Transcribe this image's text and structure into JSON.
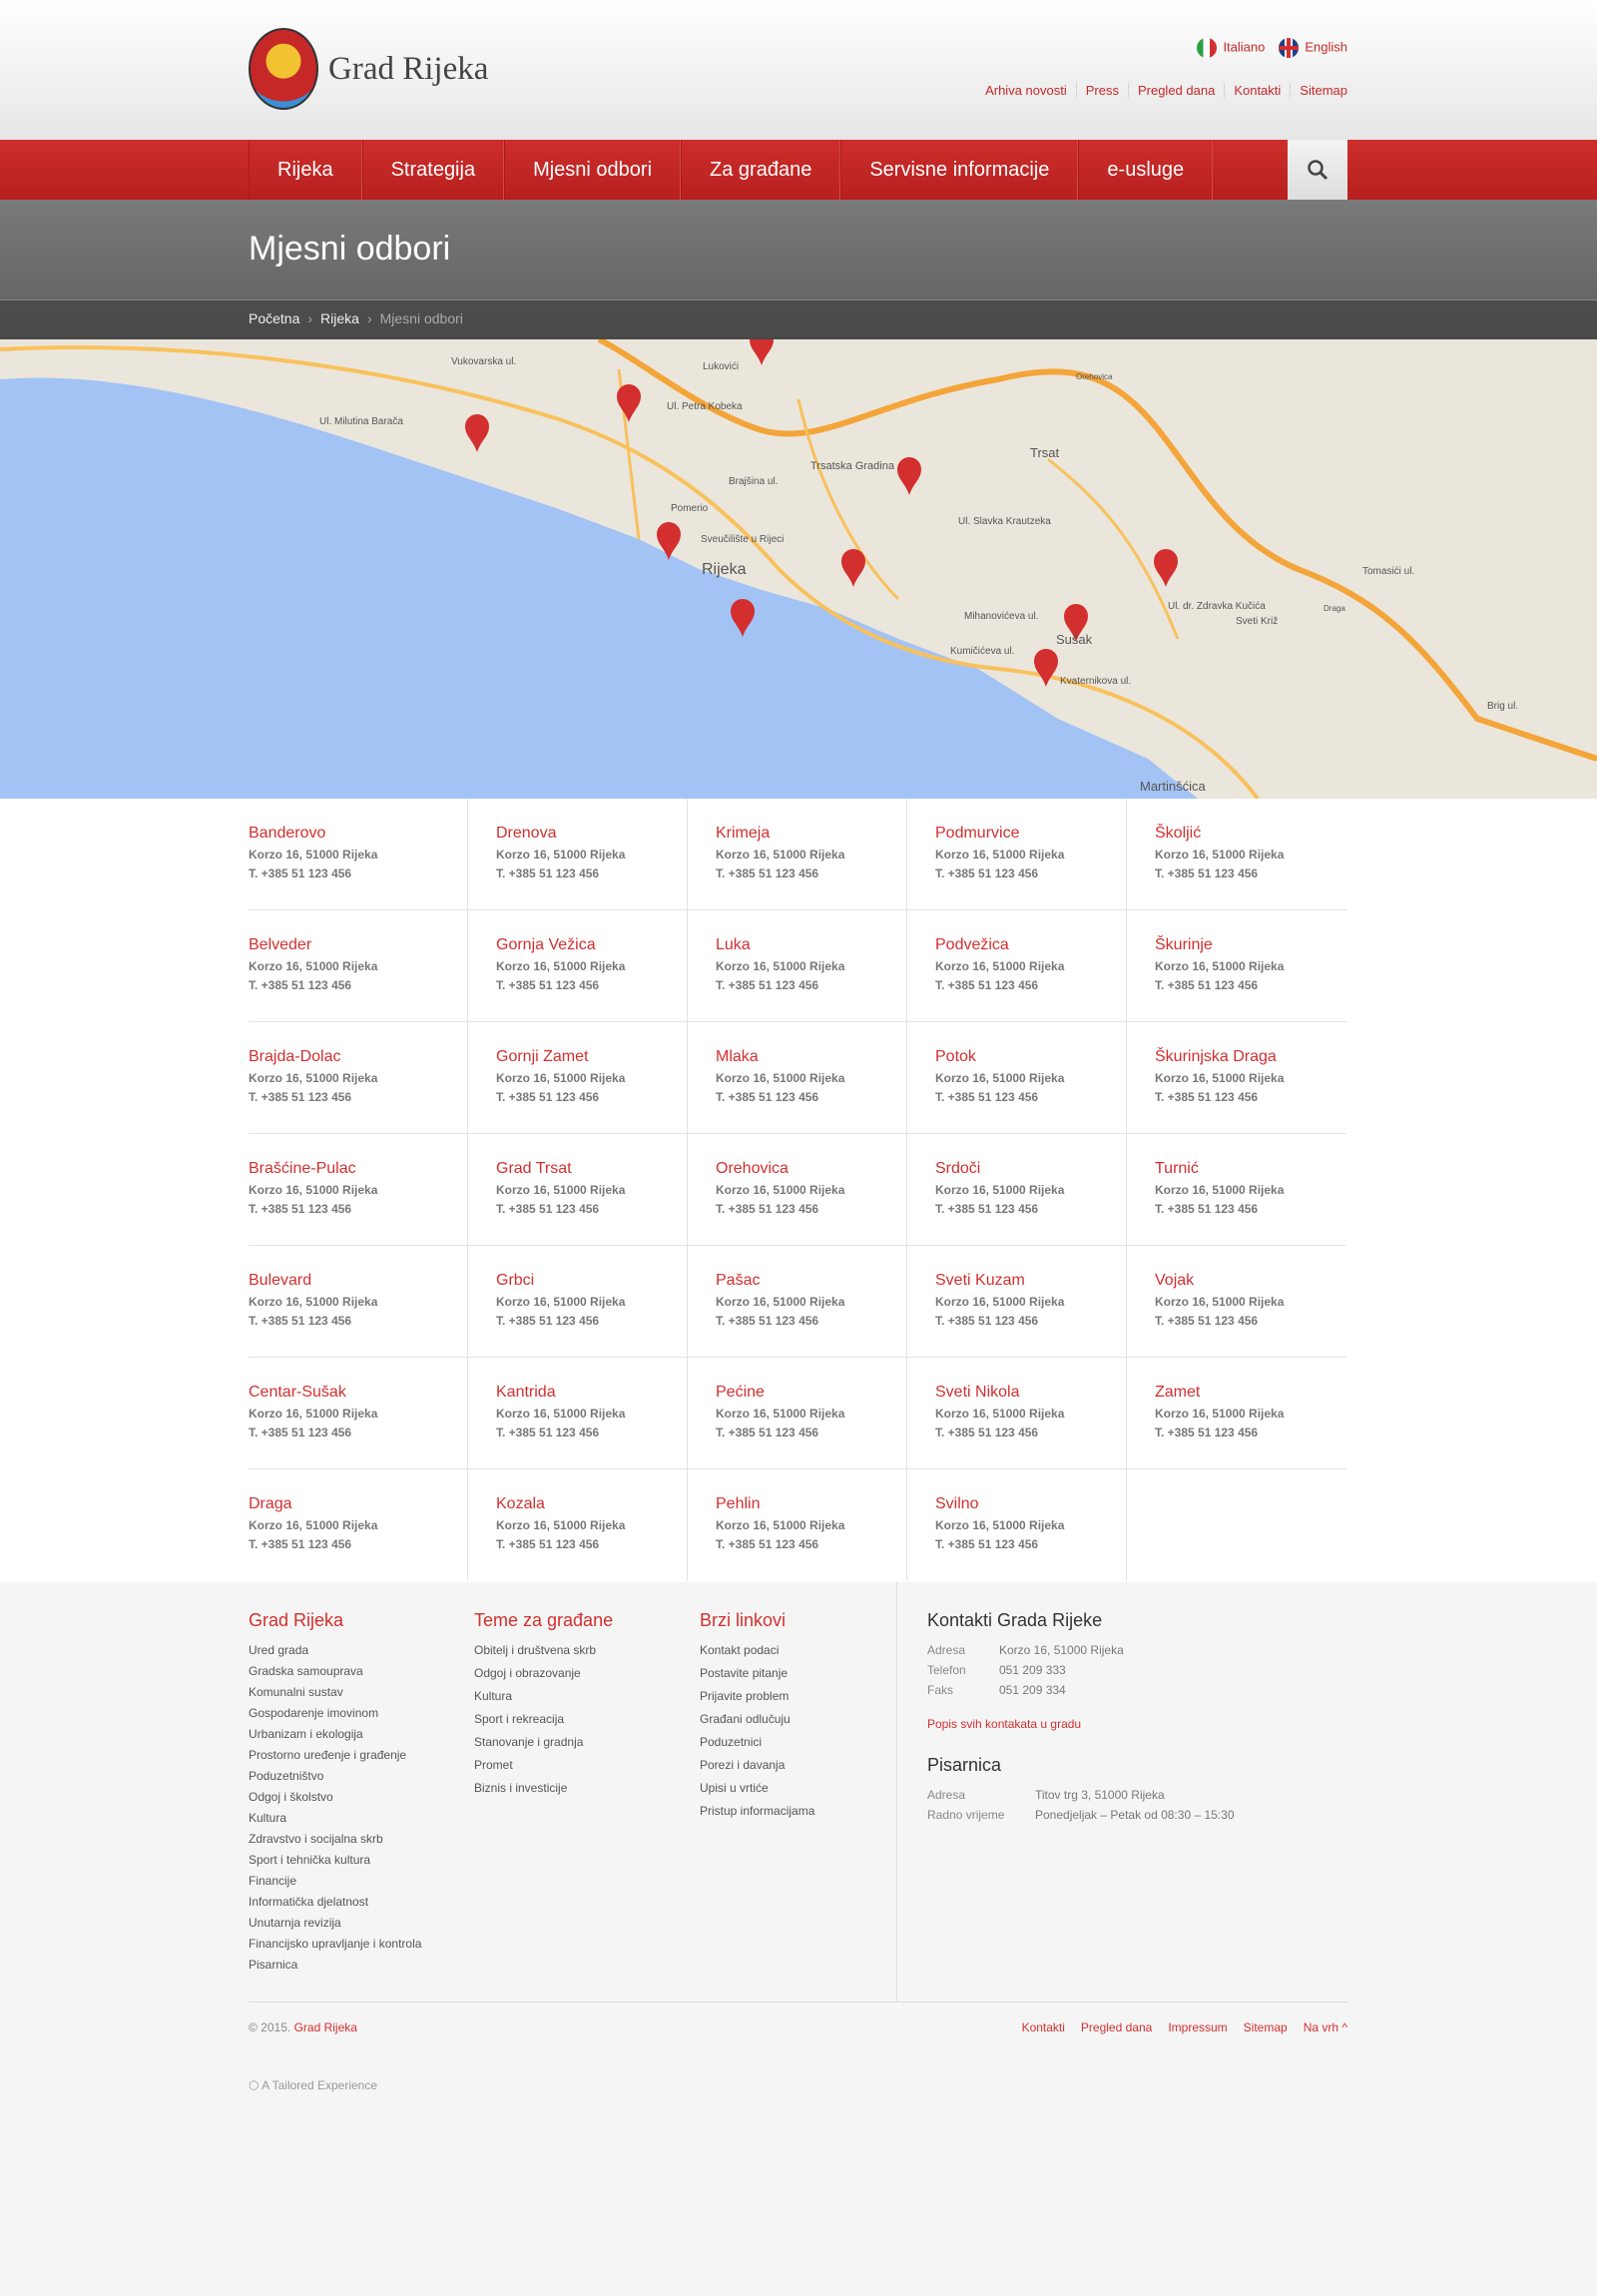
{
  "header": {
    "logo_text": "Grad Rijeka",
    "languages": [
      {
        "label": "Italiano",
        "icon": "flag-italy-icon"
      },
      {
        "label": "English",
        "icon": "flag-uk-icon"
      }
    ],
    "top_links": [
      "Arhiva novosti",
      "Press",
      "Pregled dana",
      "Kontakti",
      "Sitemap"
    ]
  },
  "nav": {
    "items": [
      "Rijeka",
      "Strategija",
      "Mjesni odbori",
      "Za građane",
      "Servisne informacije",
      "e-usluge"
    ],
    "search_icon": "search-icon"
  },
  "page": {
    "title": "Mjesni odbori",
    "breadcrumb": [
      "Početna",
      "Rijeka",
      "Mjesni odbori"
    ]
  },
  "map": {
    "labels": [
      "Rijeka",
      "Trsat",
      "Sušak",
      "Martinšćica",
      "Trsatska Gradina",
      "Sveučilište u Rijeci",
      "Ul. Milutina Barača",
      "Vukovarska ul.",
      "Ul. Petra Kobeka",
      "Brajšina ul.",
      "Pomerio",
      "Lukovići",
      "Mihanovićeva ul.",
      "Kumičićeva ul.",
      "Kvaternikova ul.",
      "Ul. Slavka Krautzeka",
      "Ul. dr. Zdravka Kučića",
      "Sveti Križ",
      "Tomasići ul.",
      "Orehovica",
      "Draga",
      "Brig ul."
    ],
    "colors": {
      "sea": "#a3c3f5",
      "land": "#ebe6dc",
      "road": "#f3a53a",
      "pin": "#d32f2f"
    }
  },
  "committees": {
    "address": "Korzo 16, 51000 Rijeka",
    "phone": "T. +385 51 123 456",
    "names": [
      "Banderovo",
      "Belveder",
      "Brajda-Dolac",
      "Brašćine-Pulac",
      "Bulevard",
      "Centar-Sušak",
      "Draga",
      "Drenova",
      "Gornja Vežica",
      "Gornji Zamet",
      "Grad Trsat",
      "Grbci",
      "Kantrida",
      "Kozala",
      "Krimeja",
      "Luka",
      "Mlaka",
      "Orehovica",
      "Pašac",
      "Pećine",
      "Pehlin",
      "Podmurvice",
      "Podvežica",
      "Potok",
      "Srdoči",
      "Sveti Kuzam",
      "Sveti Nikola",
      "Svilno",
      "Školjić",
      "Škurinje",
      "Škurinjska Draga",
      "Turnić",
      "Vojak",
      "Zamet"
    ]
  },
  "footer": {
    "col1": {
      "title": "Grad Rijeka",
      "items": [
        "Ured grada",
        "Gradska samouprava",
        "Komunalni sustav",
        "Gospodarenje imovinom",
        "Urbanizam i ekologija",
        "Prostorno uređenje i građenje",
        "Poduzetništvo",
        "Odgoj i školstvo",
        "Kultura",
        "Zdravstvo i socijalna skrb",
        "Sport i tehnička kultura",
        "Financije",
        "Informatička djelatnost",
        "Unutarnja revizija",
        "Financijsko upravljanje i kontrola",
        "Pisarnica"
      ]
    },
    "col2": {
      "title": "Teme za građane",
      "items": [
        "Obitelj i društvena skrb",
        "Odgoj i obrazovanje",
        "Kultura",
        "Sport i rekreacija",
        "Stanovanje i gradnja",
        "Promet",
        "Biznis i investicije"
      ]
    },
    "col3": {
      "title": "Brzi linkovi",
      "items": [
        "Kontakt podaci",
        "Postavite pitanje",
        "Prijavite problem",
        "Građani odlučuju",
        "Poduzetnici",
        "Porezi i davanja",
        "Upisi u vrtiće",
        "Pristup informacijama"
      ]
    },
    "contacts": {
      "title": "Kontakti Grada Rijeke",
      "rows": [
        {
          "k": "Adresa",
          "v": "Korzo 16, 51000 Rijeka"
        },
        {
          "k": "Telefon",
          "v": "051 209 333"
        },
        {
          "k": "Faks",
          "v": "051 209 334"
        }
      ],
      "link": "Popis svih kontakata u gradu"
    },
    "office": {
      "title": "Pisarnica",
      "rows": [
        {
          "k": "Adresa",
          "v": "Titov trg 3, 51000 Rijeka"
        },
        {
          "k": "Radno vrijeme",
          "v": "Ponedjeljak – Petak od 08:30 – 15:30"
        }
      ]
    },
    "copyright": "© 2015.",
    "copyright_link": "Grad Rijeka",
    "bottom_links": [
      "Kontakti",
      "Pregled dana",
      "Impressum",
      "Sitemap",
      "Na vrh ^"
    ],
    "tailored": "A Tailored Experience"
  }
}
